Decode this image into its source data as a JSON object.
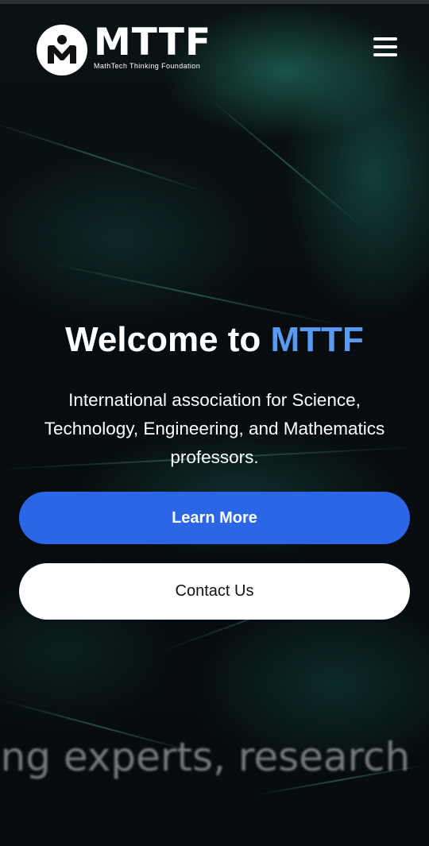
{
  "header": {
    "logo": {
      "title": "MTTF",
      "subtitle": "MathTech Thinking Foundation",
      "mark_icon": "mttf-logo-mark"
    },
    "menu_icon": "hamburger-menu-icon"
  },
  "hero": {
    "title_prefix": "Welcome to ",
    "title_accent": "MTTF",
    "description": "International association for Science, Technology, Engineering, and Mathematics professors.",
    "primary_button": "Learn More",
    "secondary_button": "Contact Us"
  },
  "marquee": {
    "text": "ong experts, research"
  },
  "colors": {
    "accent": "#5a9bf2",
    "primary_button": "#2a66e5",
    "background": "#05090c"
  }
}
